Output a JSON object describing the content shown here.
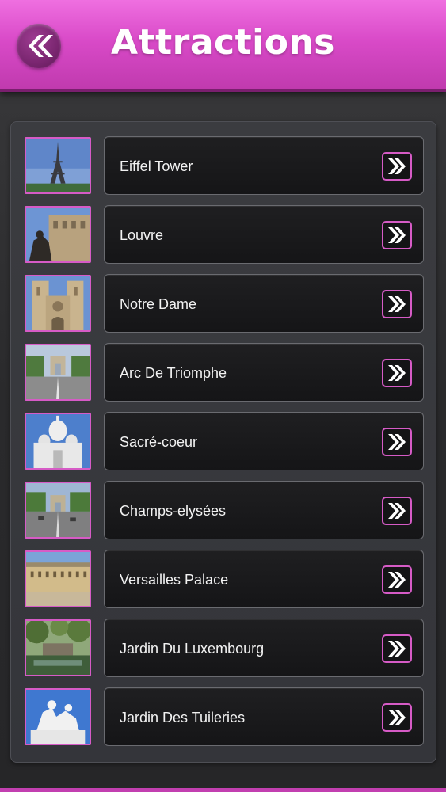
{
  "header": {
    "title": "Attractions",
    "back_icon": "double-chevron-left-icon",
    "accent_color": "#d94ac8"
  },
  "list": {
    "row_icon": "double-chevron-right-icon",
    "items": [
      {
        "label": "Eiffel Tower",
        "thumb": "eiffel"
      },
      {
        "label": "Louvre",
        "thumb": "louvre"
      },
      {
        "label": "Notre Dame",
        "thumb": "notredame"
      },
      {
        "label": "Arc De Triomphe",
        "thumb": "arc"
      },
      {
        "label": "Sacré-coeur",
        "thumb": "sacre"
      },
      {
        "label": "Champs-elysées",
        "thumb": "champs"
      },
      {
        "label": "Versailles Palace",
        "thumb": "versailles"
      },
      {
        "label": "Jardin Du Luxembourg",
        "thumb": "luxembourg"
      },
      {
        "label": "Jardin Des Tuileries",
        "thumb": "tuileries"
      }
    ]
  }
}
